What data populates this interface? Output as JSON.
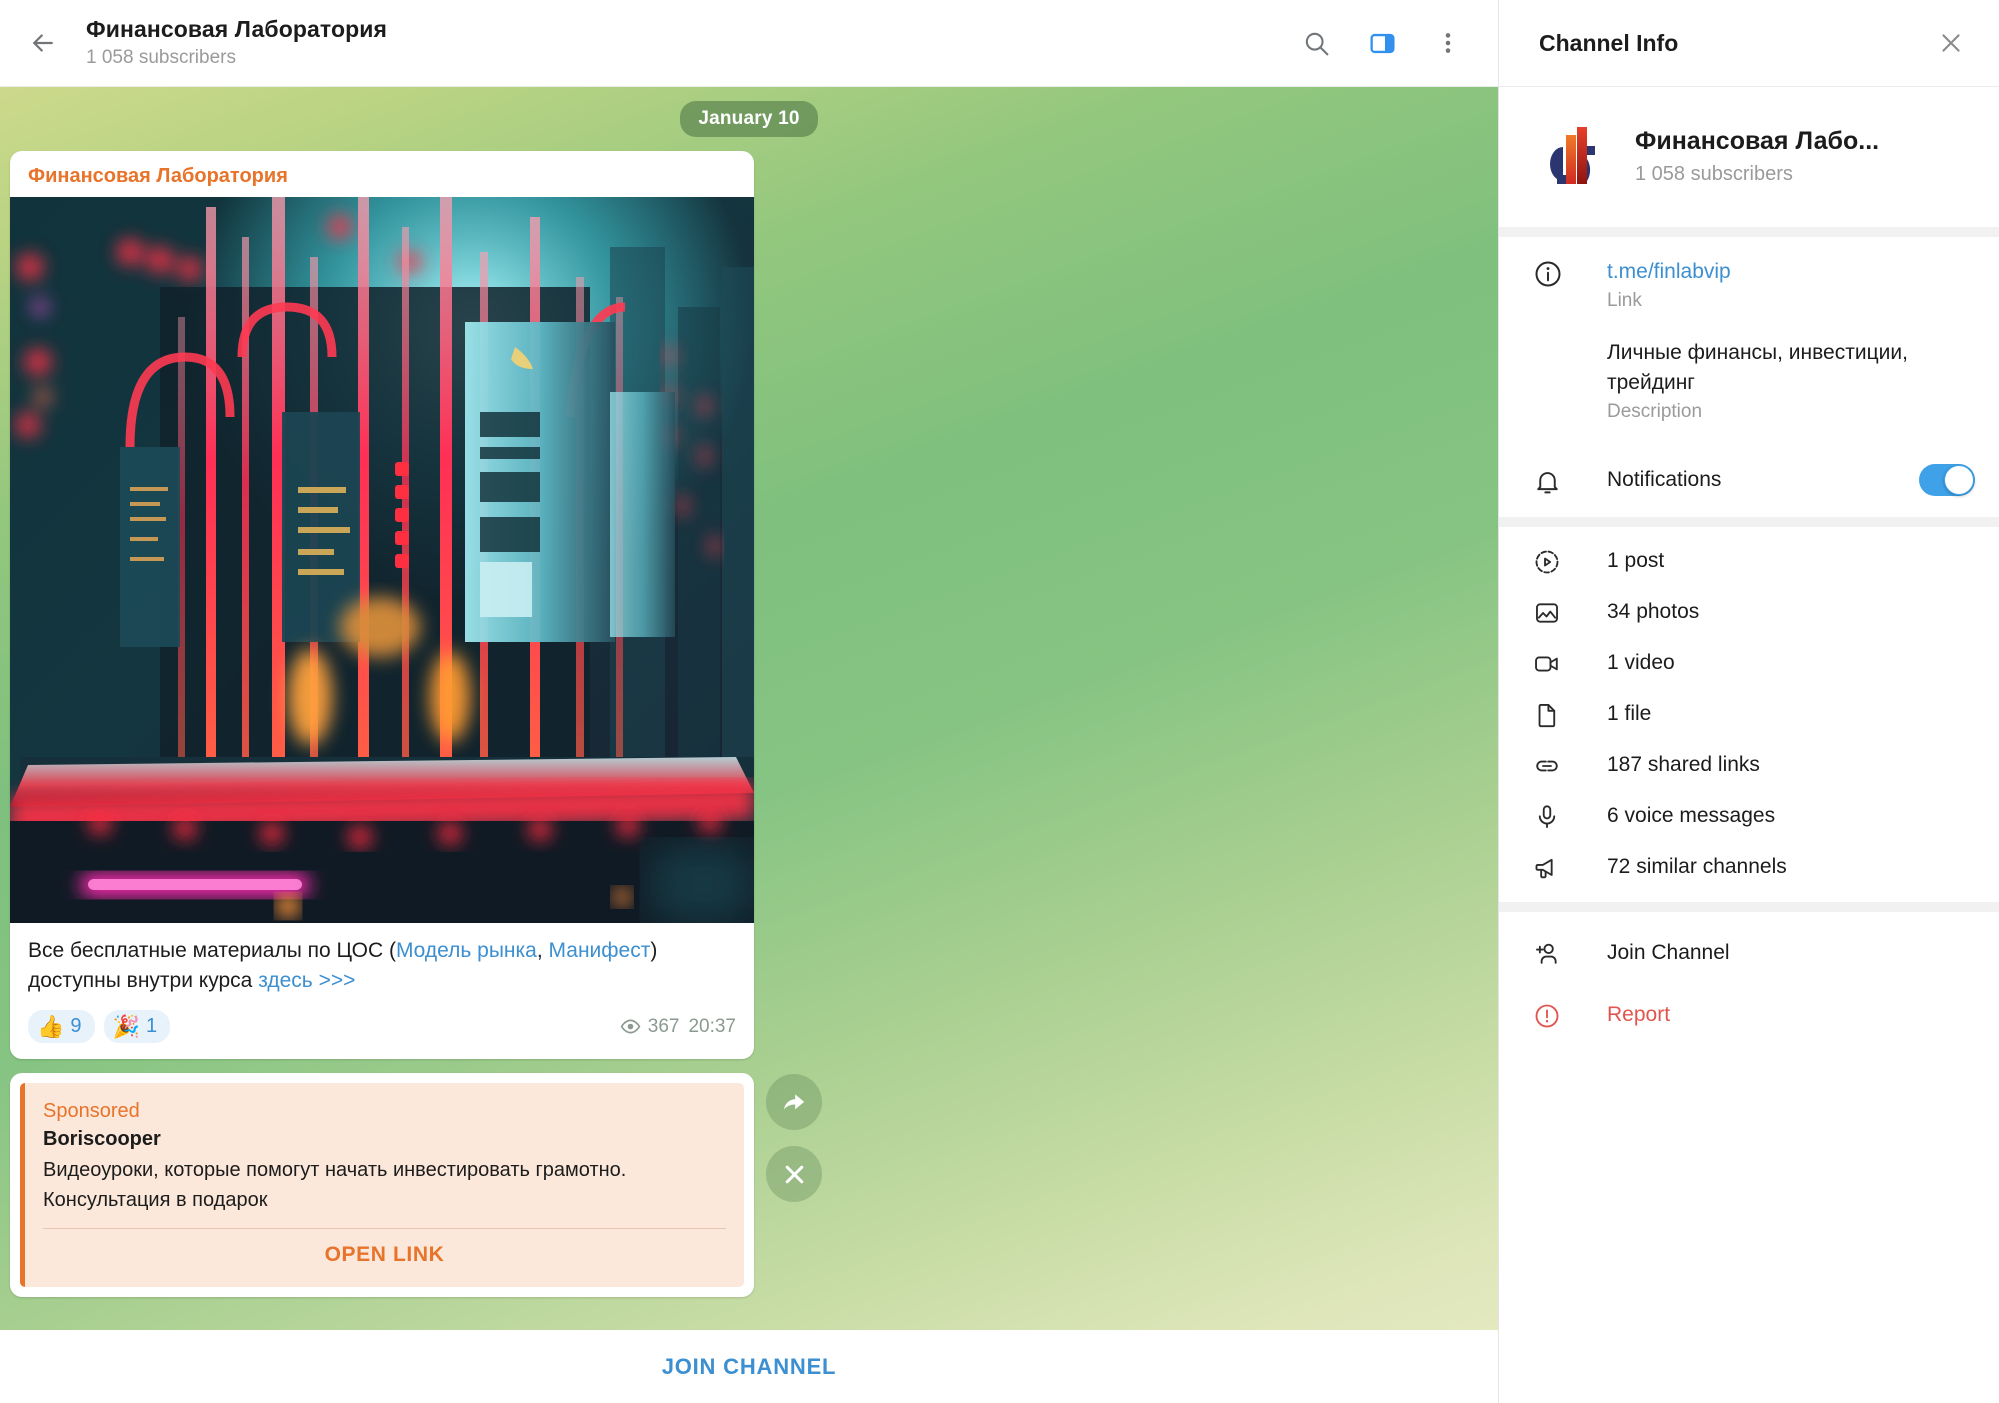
{
  "header": {
    "back_icon": "arrow-left-icon",
    "title": "Финансовая Лаборатория",
    "subscribers": "1 058 subscribers",
    "actions": [
      {
        "name": "search-icon",
        "label": "Search"
      },
      {
        "name": "sidebar-toggle-icon",
        "label": "Toggle Info"
      },
      {
        "name": "more-vertical-icon",
        "label": "More"
      }
    ]
  },
  "chat": {
    "date_divider": "January 10",
    "message": {
      "author": "Финансовая Лаборатория",
      "photo_alt": "neon cyberpunk server tower render",
      "caption_parts": [
        {
          "t": "Все бесплатные материалы по ЦОС (",
          "link": false
        },
        {
          "t": "Модель рынка",
          "link": true
        },
        {
          "t": ", ",
          "link": false
        },
        {
          "t": "Манифест",
          "link": true
        },
        {
          "t": ") доступны внутри курса ",
          "link": false
        },
        {
          "t": "здесь >>>",
          "link": true
        }
      ],
      "reactions": [
        {
          "emoji": "👍",
          "count": "9"
        },
        {
          "emoji": "🎉",
          "count": "1"
        }
      ],
      "views": "367",
      "time": "20:37"
    },
    "sponsored": {
      "label": "Sponsored",
      "name": "Boriscooper",
      "text": "Видеоуроки, которые помогут начать инвестировать грамотно. Консультация в подарок",
      "cta": "OPEN LINK"
    },
    "float_buttons": [
      {
        "name": "share-forward-icon",
        "label": "Forward"
      },
      {
        "name": "close-icon",
        "label": "Close"
      }
    ],
    "join_button": "JOIN CHANNEL"
  },
  "info_panel": {
    "title": "Channel Info",
    "close_icon": "close-icon",
    "profile": {
      "name": "Финансовая Лабо...",
      "subscribers": "1 058 subscribers",
      "avatar_icon": "channel-logo-icon",
      "avatar_colors": {
        "navy": "#2b3570",
        "orange": "#e8732a",
        "red": "#d42a22",
        "darkred": "#8e1410"
      }
    },
    "link_row": {
      "icon": "info-circle-icon",
      "value": "t.me/finlabvip",
      "caption": "Link"
    },
    "description_row": {
      "value": "Личные финансы, инвестиции, трейдинг",
      "caption": "Description"
    },
    "notifications_row": {
      "icon": "bell-icon",
      "label": "Notifications",
      "toggle_on": true,
      "toggle_color": "#3fa2e8"
    },
    "stats": [
      {
        "icon": "post-play-icon",
        "label": "1 post"
      },
      {
        "icon": "photo-icon",
        "label": "34 photos"
      },
      {
        "icon": "video-icon",
        "label": "1 video"
      },
      {
        "icon": "file-icon",
        "label": "1 file"
      },
      {
        "icon": "link-icon",
        "label": "187 shared links"
      },
      {
        "icon": "microphone-icon",
        "label": "6 voice messages"
      },
      {
        "icon": "megaphone-icon",
        "label": "72 similar channels"
      }
    ],
    "actions": [
      {
        "icon": "add-user-icon",
        "label": "Join Channel",
        "danger": false
      },
      {
        "icon": "report-alert-icon",
        "label": "Report",
        "danger": true
      }
    ]
  },
  "theme": {
    "accent_blue": "#3c8fd0",
    "sponsor_orange": "#e8732a",
    "danger_red": "#e0564f",
    "chat_bg_start": "#cdd98c",
    "chat_bg_end": "#e4e9c0"
  }
}
